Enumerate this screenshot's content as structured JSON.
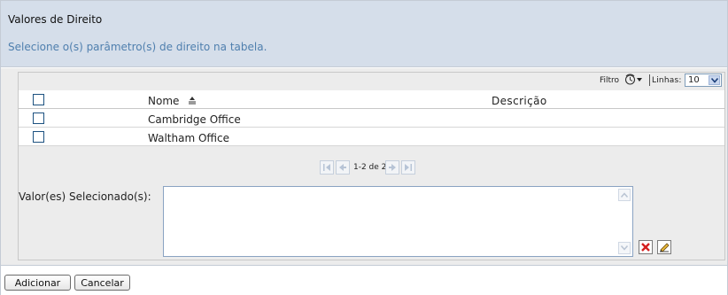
{
  "header": {
    "title": "Valores de Direito",
    "subtitle": "Selecione o(s) parâmetro(s) de direito na tabela."
  },
  "toolbar": {
    "filter_label": "Filtro",
    "rows_label": "Linhas:",
    "rows_value": "10"
  },
  "table": {
    "columns": {
      "name": "Nome",
      "description": "Descrição"
    },
    "rows": [
      {
        "name": "Cambridge Office",
        "description": ""
      },
      {
        "name": "Waltham Office",
        "description": ""
      }
    ]
  },
  "pager": {
    "info": "1-2 de 2"
  },
  "selected": {
    "label": "Valor(es) Selecionado(s):",
    "value": ""
  },
  "footer": {
    "add_label": "Adicionar",
    "cancel_label": "Cancelar"
  },
  "icons": {
    "filter": "filter-clock-icon",
    "sort": "sort-ascending-icon",
    "first": "first-page-icon",
    "prev": "previous-page-icon",
    "next": "next-page-icon",
    "last": "last-page-icon",
    "delete": "delete-x-icon",
    "edit": "edit-pencil-icon"
  },
  "colors": {
    "header_bg": "#d5deea",
    "subtitle": "#4f7fae",
    "panel_bg": "#ececec",
    "delete_red": "#d42020"
  }
}
